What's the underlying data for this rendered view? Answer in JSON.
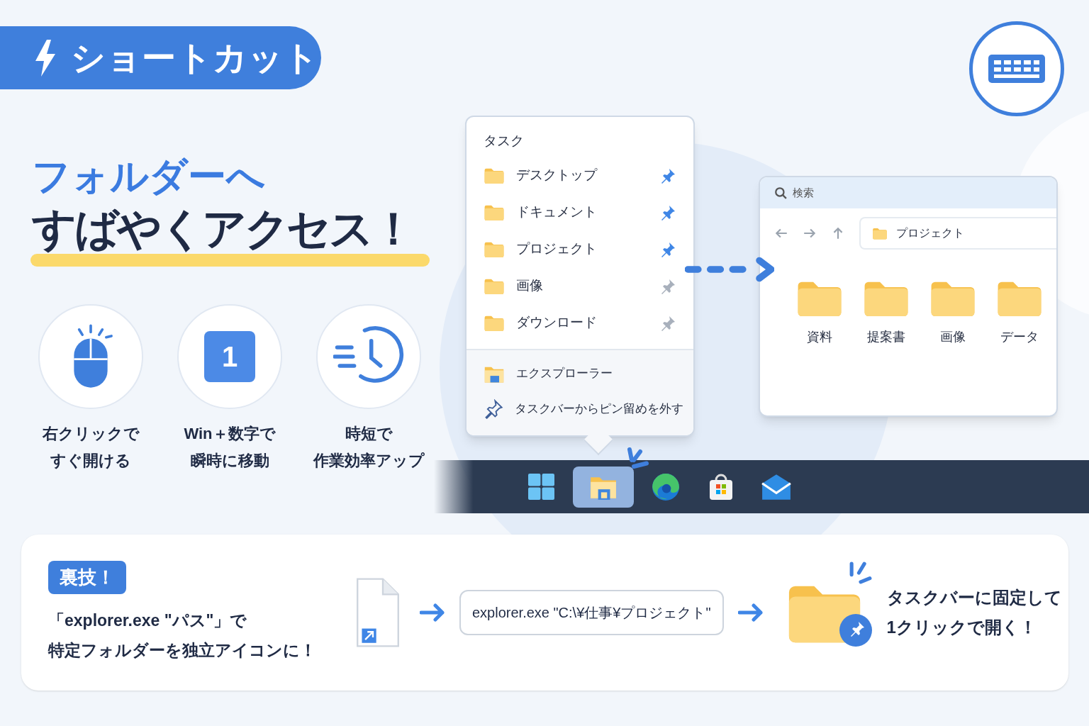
{
  "banner": {
    "title": "ショートカット"
  },
  "headline": {
    "line1": "フォルダーへ",
    "line2": "すばやくアクセス！"
  },
  "features": [
    {
      "kind": "mouse",
      "lines": [
        "右クリックで",
        "すぐ開ける"
      ]
    },
    {
      "kind": "key",
      "key": "1",
      "lines": [
        "Win＋数字で",
        "瞬時に移動"
      ]
    },
    {
      "kind": "clock",
      "lines": [
        "時短で",
        "作業効率アップ"
      ]
    }
  ],
  "jump_list": {
    "heading": "タスク",
    "items": [
      {
        "label": "デスクトップ",
        "pinned": true
      },
      {
        "label": "ドキュメント",
        "pinned": true
      },
      {
        "label": "プロジェクト",
        "pinned": true
      },
      {
        "label": "画像",
        "pinned": false
      },
      {
        "label": "ダウンロード",
        "pinned": false
      }
    ],
    "actions": [
      {
        "kind": "explorer",
        "label": "エクスプローラー"
      },
      {
        "kind": "unpin",
        "label": "タスクバーからピン留めを外す"
      }
    ]
  },
  "explorer": {
    "search": {
      "placeholder": "検索"
    },
    "path": "プロジェクト",
    "folders": [
      "資料",
      "提案書",
      "画像",
      "データ"
    ]
  },
  "taskbar": {
    "apps": [
      {
        "kind": "start",
        "selected": false
      },
      {
        "kind": "explorer",
        "selected": true
      },
      {
        "kind": "edge",
        "selected": false
      },
      {
        "kind": "store",
        "selected": false
      },
      {
        "kind": "mail",
        "selected": false
      }
    ]
  },
  "tip": {
    "badge": "裏技！",
    "text_lines": [
      "「explorer.exe \"パス\"」で",
      "特定フォルダーを独立アイコンに！"
    ],
    "command": "explorer.exe \"C:\\¥仕事¥プロジェクト\"",
    "result_lines": [
      "タスクバーに固定して",
      "1クリックで開く！"
    ]
  }
}
